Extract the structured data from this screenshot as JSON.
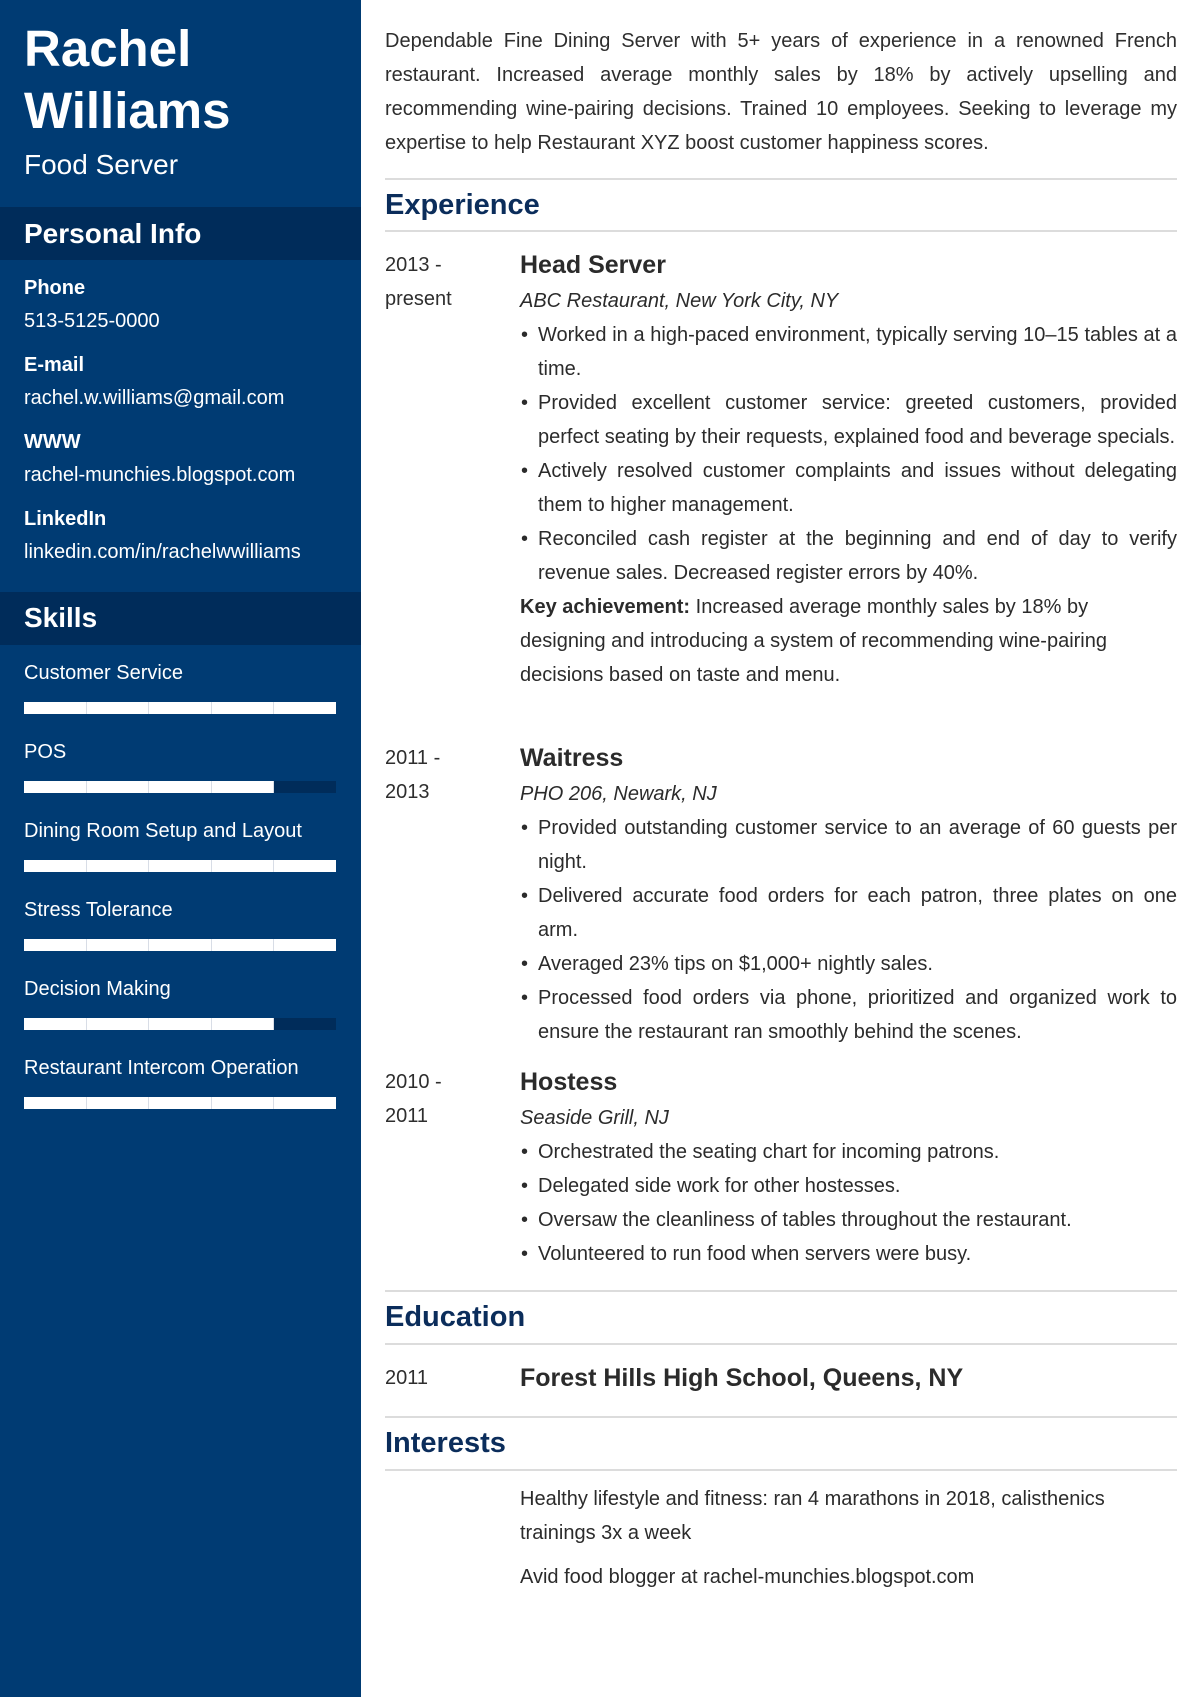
{
  "header": {
    "first_name": "Rachel",
    "last_name": "Williams",
    "role": "Food Server"
  },
  "sidebar": {
    "personal_info_title": "Personal Info",
    "contacts": [
      {
        "label": "Phone",
        "value": "513-5125-0000"
      },
      {
        "label": "E-mail",
        "value": "rachel.w.williams@gmail.com"
      },
      {
        "label": "WWW",
        "value": "rachel-munchies.blogspot.com"
      },
      {
        "label": "LinkedIn",
        "value": "linkedin.com/in/rachelwwilliams"
      }
    ],
    "skills_title": "Skills",
    "skills_scale_max": 5,
    "skills": [
      {
        "name": "Customer Service",
        "level": 5
      },
      {
        "name": "POS",
        "level": 4
      },
      {
        "name": "Dining Room Setup and Layout",
        "level": 5
      },
      {
        "name": "Stress Tolerance",
        "level": 5
      },
      {
        "name": "Decision Making",
        "level": 4
      },
      {
        "name": "Restaurant Intercom Operation",
        "level": 5
      }
    ]
  },
  "summary": "Dependable Fine Dining Server with 5+ years of experience in a renowned French restaurant. Increased average monthly sales by 18% by actively upselling and recommending wine-pairing decisions. Trained 10 employees. Seeking to leverage my expertise to help Restaurant XYZ boost customer happiness scores.",
  "experience": {
    "title": "Experience",
    "jobs": [
      {
        "date_start": "2013 -",
        "date_end": "present",
        "title": "Head Server",
        "company": "ABC Restaurant, New York City, NY",
        "bullets": [
          "Worked in a high-paced environment, typically serving 10–15 tables at a time.",
          "Provided excellent customer service: greeted customers, provided perfect seating by their requests, explained food and beverage specials.",
          "Actively resolved customer complaints and issues without delegating them to higher management.",
          "Reconciled cash register at the beginning and end of day to verify revenue sales. Decreased register errors by 40%."
        ],
        "key_label": "Key achievement:",
        "key_text": " Increased average monthly sales by 18% by designing and introducing a system of recommending wine-pairing decisions based on taste and menu."
      },
      {
        "date_start": "2011 -",
        "date_end": "2013",
        "title": "Waitress",
        "company": "PHO 206, Newark, NJ",
        "bullets": [
          "Provided outstanding customer service to an average of 60 guests per night.",
          "Delivered accurate food orders for each patron, three plates on one arm.",
          "Averaged 23% tips on $1,000+ nightly sales.",
          "Processed food orders via phone, prioritized and organized work to ensure the restaurant ran smoothly behind the scenes."
        ]
      },
      {
        "date_start": "2010 -",
        "date_end": "2011",
        "title": "Hostess",
        "company": "Seaside Grill, NJ",
        "bullets": [
          "Orchestrated the seating chart for incoming patrons.",
          "Delegated side work for other hostesses.",
          "Oversaw the cleanliness of tables throughout the restaurant.",
          "Volunteered to run food when servers were busy."
        ]
      }
    ]
  },
  "education": {
    "title": "Education",
    "year": "2011",
    "school": "Forest Hills High School, Queens, NY"
  },
  "interests": {
    "title": "Interests",
    "items": [
      "Healthy lifestyle and fitness: ran 4 marathons in 2018, calisthenics trainings 3x a week",
      "Avid food blogger at rachel-munchies.blogspot.com"
    ]
  },
  "colors": {
    "sidebar": "#003b73",
    "sidebar_band": "#002c5a",
    "heading": "#0b2d5b",
    "text": "#2b2b2b",
    "rule": "#dcdcdc"
  }
}
